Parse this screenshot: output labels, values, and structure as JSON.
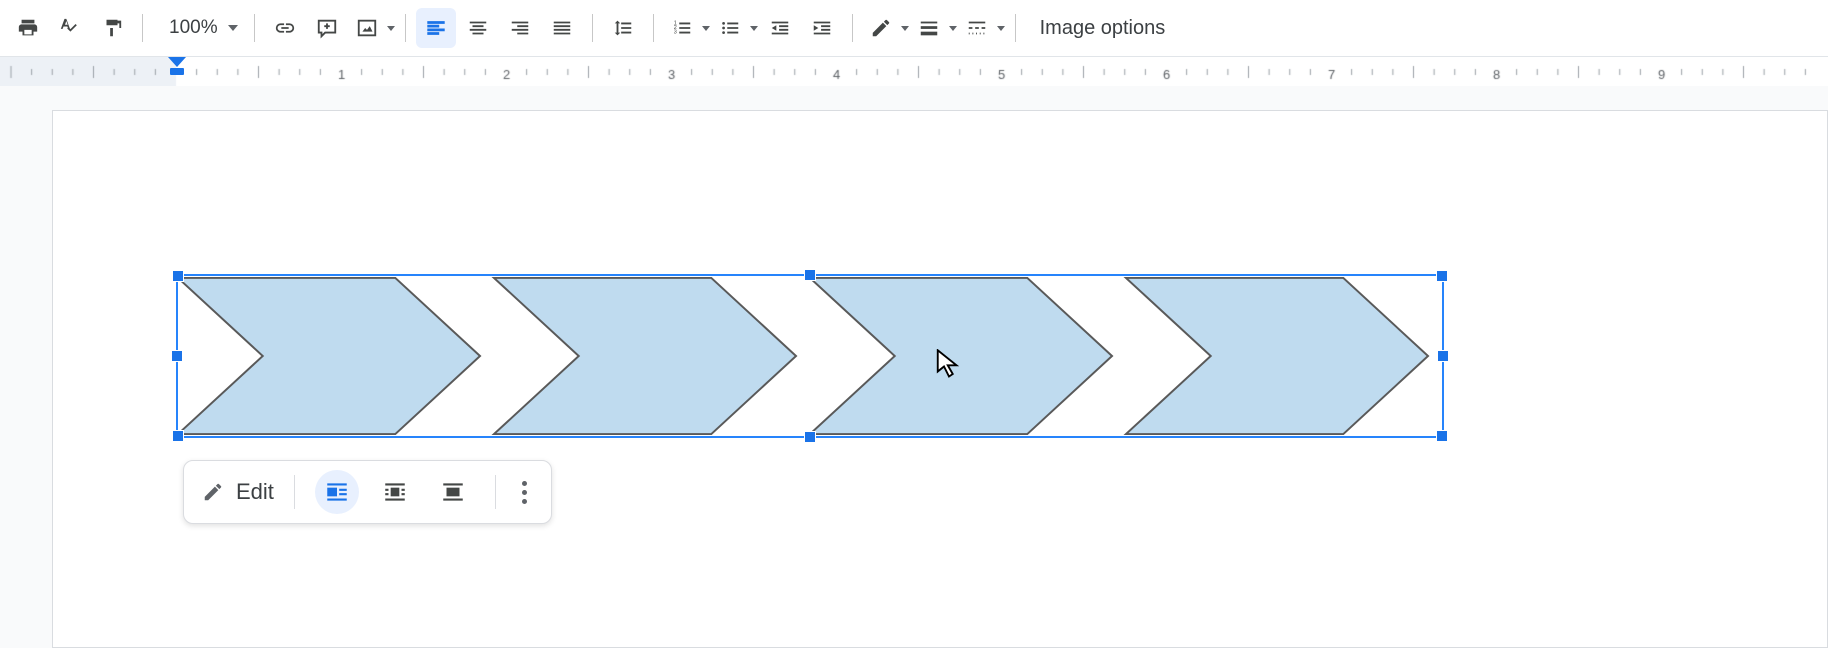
{
  "toolbar": {
    "zoom": "100%",
    "image_options_label": "Image options"
  },
  "ruler": {
    "labels": [
      "1",
      "2",
      "3",
      "4",
      "5",
      "6",
      "7",
      "8"
    ]
  },
  "drawing": {
    "fill": "#bfdbef",
    "stroke": "#595959",
    "chevron_count": 4
  },
  "float_toolbar": {
    "edit_label": "Edit"
  }
}
